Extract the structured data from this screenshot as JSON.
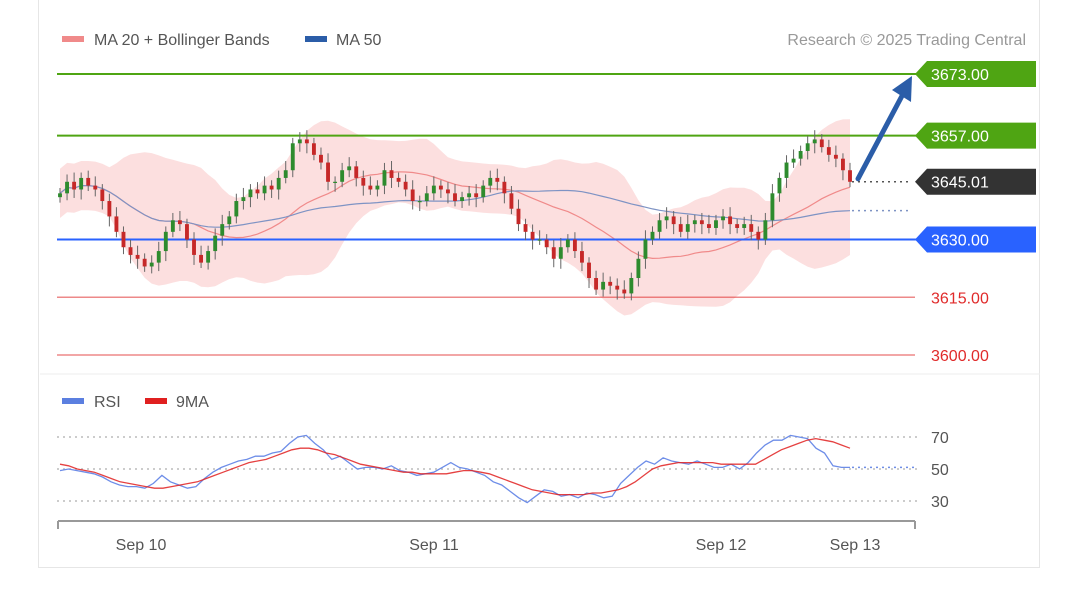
{
  "legend_main": [
    {
      "label": "MA 20 + Bollinger Bands",
      "color": "#f08a8a"
    },
    {
      "label": "MA 50",
      "color": "#2b5da8"
    }
  ],
  "credit": "Research © 2025 Trading Central",
  "legend_rsi": [
    {
      "label": "RSI",
      "color": "#5b7fe0"
    },
    {
      "label": "9MA",
      "color": "#e02020"
    }
  ],
  "chart_data": [
    {
      "type": "candlestick",
      "title": "",
      "ylim": [
        3597,
        3678
      ],
      "x_ticks": [
        "Sep 10",
        "Sep 11",
        "Sep 12",
        "Sep 13"
      ],
      "levels": [
        {
          "value": 3673.0,
          "label": "3673.00",
          "color": "#4fa513",
          "style": "tag"
        },
        {
          "value": 3657.0,
          "label": "3657.00",
          "color": "#4fa513",
          "style": "tag"
        },
        {
          "value": 3645.01,
          "label": "3645.01",
          "color": "#333333",
          "style": "tag",
          "current": true
        },
        {
          "value": 3630.0,
          "label": "3630.00",
          "color": "#2962ff",
          "style": "tag"
        },
        {
          "value": 3615.0,
          "label": "3615.00",
          "color": "#e02a2a",
          "style": "plain"
        },
        {
          "value": 3600.0,
          "label": "3600.00",
          "color": "#e02a2a",
          "style": "plain"
        }
      ],
      "ma50_end_value": 3637.5,
      "forecast_arrow": {
        "from": 3645.0,
        "to": 3673.0
      },
      "price_path": [
        3642,
        3645,
        3643,
        3646,
        3644,
        3643,
        3640,
        3636,
        3632,
        3628,
        3626,
        3625,
        3623,
        3624,
        3627,
        3632,
        3635,
        3634,
        3630,
        3626,
        3624,
        3627,
        3631,
        3634,
        3636,
        3640,
        3641,
        3643,
        3642,
        3644,
        3643,
        3646,
        3648,
        3655,
        3656,
        3655,
        3652,
        3650,
        3645,
        3645,
        3648,
        3649,
        3646,
        3644,
        3643,
        3644,
        3648,
        3646,
        3645,
        3643,
        3640,
        3640,
        3642,
        3644,
        3643,
        3642,
        3640,
        3641,
        3642,
        3641,
        3644,
        3646,
        3645,
        3642,
        3638,
        3634,
        3632,
        3630,
        3630,
        3628,
        3625,
        3628,
        3630,
        3627,
        3624,
        3620,
        3617,
        3619,
        3618,
        3617,
        3616,
        3620,
        3625,
        3630,
        3632,
        3635,
        3636,
        3634,
        3632,
        3634,
        3635,
        3634,
        3633,
        3635,
        3636,
        3634,
        3633,
        3634,
        3632,
        3630,
        3635,
        3642,
        3646,
        3650,
        3651,
        3653,
        3655,
        3656,
        3654,
        3652,
        3651,
        3648,
        3645
      ]
    },
    {
      "type": "line",
      "title": "RSI",
      "ylim": [
        20,
        80
      ],
      "y_ticks": [
        70,
        50,
        30
      ],
      "series": [
        {
          "name": "RSI",
          "values": [
            49,
            50,
            49,
            48,
            47,
            45,
            42,
            40,
            39,
            39,
            38,
            41,
            46,
            42,
            40,
            38,
            39,
            44,
            48,
            51,
            53,
            55,
            56,
            58,
            58,
            60,
            61,
            66,
            70,
            71,
            66,
            62,
            56,
            58,
            54,
            50,
            51,
            51,
            50,
            52,
            49,
            48,
            46,
            47,
            48,
            51,
            54,
            51,
            50,
            48,
            46,
            42,
            40,
            36,
            32,
            29,
            33,
            37,
            36,
            33,
            34,
            32,
            35,
            34,
            32,
            33,
            41,
            46,
            51,
            55,
            53,
            57,
            55,
            54,
            53,
            55,
            53,
            51,
            51,
            53,
            50,
            54,
            60,
            65,
            68,
            68,
            71,
            70,
            69,
            63,
            60,
            52,
            51,
            51
          ]
        },
        {
          "name": "9MA",
          "values": [
            53,
            52,
            50,
            49,
            48,
            46,
            44,
            42,
            41,
            40,
            39,
            38,
            38,
            39,
            40,
            41,
            42,
            44,
            46,
            48,
            50,
            52,
            54,
            55,
            56,
            58,
            60,
            62,
            63,
            63,
            62,
            60,
            59,
            57,
            55,
            53,
            52,
            51,
            50,
            49,
            48,
            48,
            47,
            47,
            47,
            47,
            48,
            49,
            49,
            48,
            47,
            45,
            43,
            41,
            39,
            37,
            36,
            35,
            34,
            34,
            34,
            34,
            35,
            35,
            36,
            37,
            39,
            42,
            46,
            50,
            52,
            53,
            54,
            54,
            54,
            54,
            54,
            53,
            53,
            53,
            53,
            53,
            56,
            59,
            62,
            64,
            66,
            68,
            69,
            68,
            67,
            65,
            63
          ]
        }
      ]
    }
  ]
}
